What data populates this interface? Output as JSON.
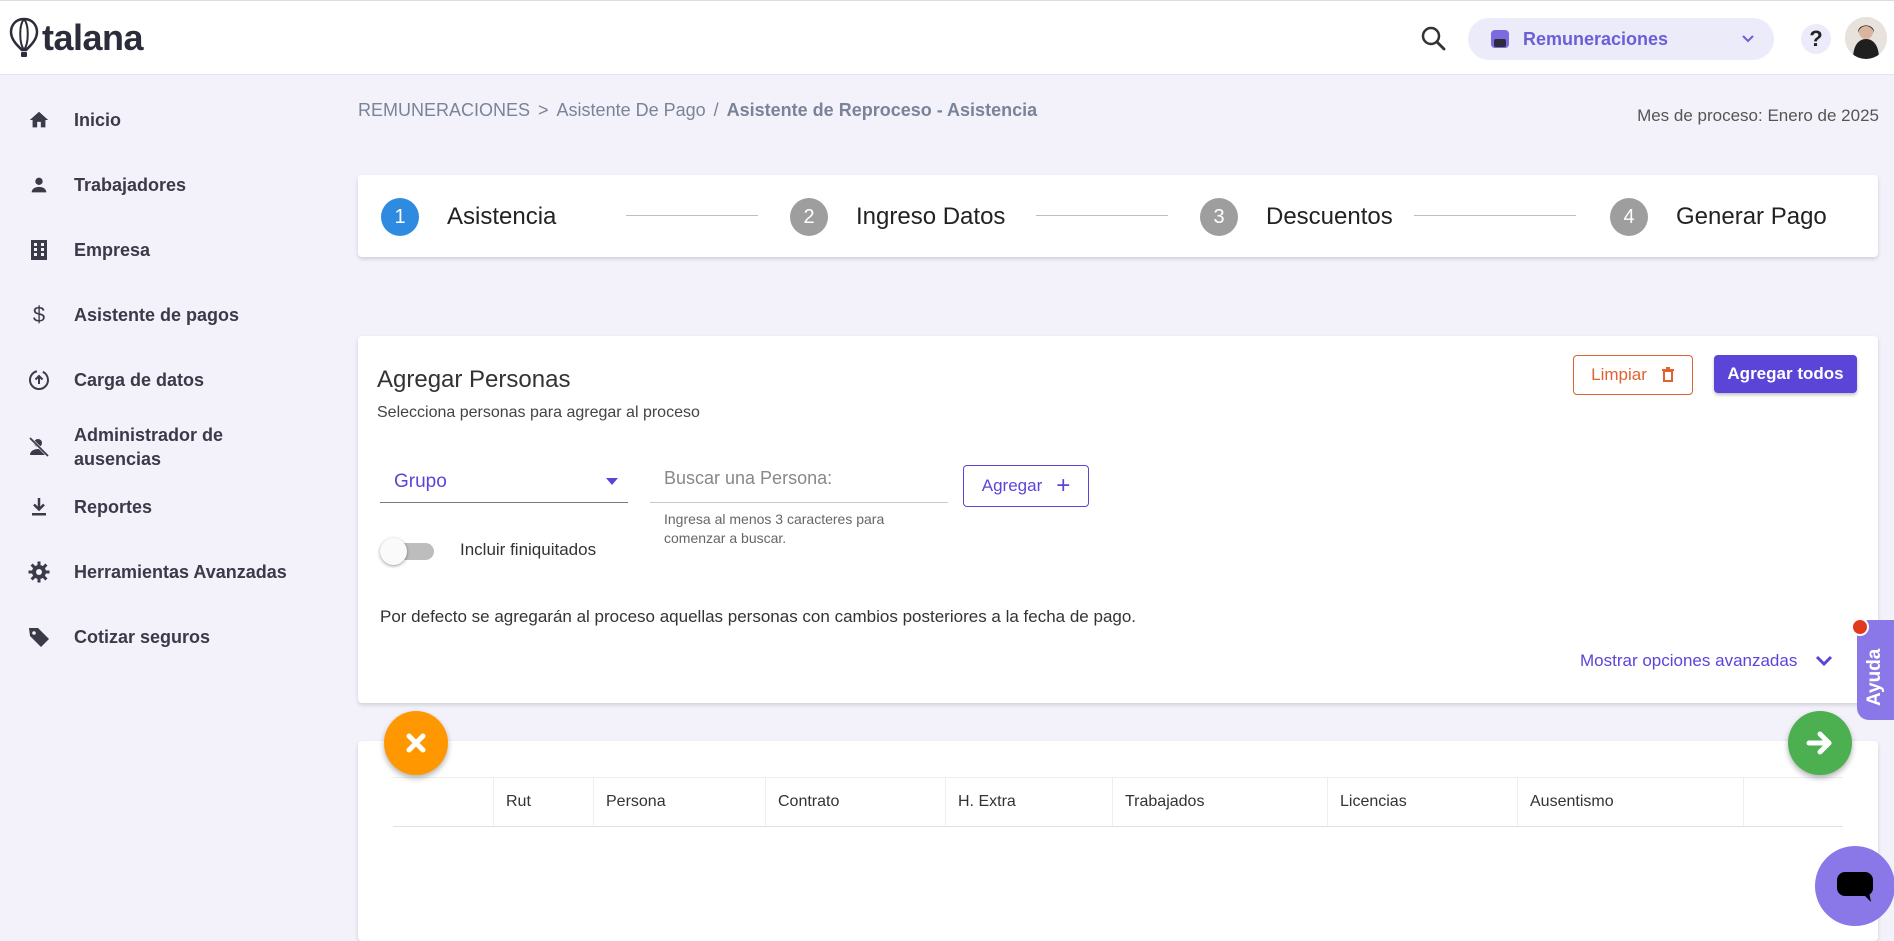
{
  "brand": {
    "name": "talana"
  },
  "header": {
    "module_selector": {
      "label": "Remuneraciones"
    },
    "help_label": "?"
  },
  "sidebar": {
    "items": [
      {
        "label": "Inicio",
        "icon": "home-icon"
      },
      {
        "label": "Trabajadores",
        "icon": "person-icon"
      },
      {
        "label": "Empresa",
        "icon": "building-icon"
      },
      {
        "label": "Asistente de pagos",
        "icon": "dollar-icon"
      },
      {
        "label": "Carga de datos",
        "icon": "upload-circle-icon"
      },
      {
        "label": "Administrador de ausencias",
        "icon": "person-off-icon"
      },
      {
        "label": "Reportes",
        "icon": "download-icon"
      },
      {
        "label": "Herramientas Avanzadas",
        "icon": "gear-icon"
      },
      {
        "label": "Cotizar seguros",
        "icon": "tag-icon"
      }
    ]
  },
  "breadcrumb": {
    "root": "REMUNERACIONES",
    "sep1": ">",
    "parent": "Asistente De Pago",
    "sep2": "/",
    "current": "Asistente de Reproceso - Asistencia"
  },
  "process_month": "Mes de proceso: Enero de 2025",
  "stepper": {
    "steps": [
      {
        "number": "1",
        "label": "Asistencia",
        "active": true
      },
      {
        "number": "2",
        "label": "Ingreso Datos",
        "active": false
      },
      {
        "number": "3",
        "label": "Descuentos",
        "active": false
      },
      {
        "number": "4",
        "label": "Generar Pago",
        "active": false
      }
    ]
  },
  "add_people": {
    "title": "Agregar Personas",
    "subtitle": "Selecciona personas para agregar al proceso",
    "clear_label": "Limpiar",
    "add_all_label": "Agregar todos",
    "group_select": {
      "value": "Grupo"
    },
    "search": {
      "placeholder": "Buscar una Persona:",
      "hint": "Ingresa al menos 3 caracteres para comenzar a buscar."
    },
    "add_label": "Agregar",
    "include_terminated": {
      "label": "Incluir finiquitados",
      "checked": false
    },
    "default_note": "Por defecto se agregarán al proceso aquellas personas con cambios posteriores a la fecha de pago.",
    "advanced_link": "Mostrar opciones avanzadas"
  },
  "table": {
    "columns": [
      "",
      "Rut",
      "Persona",
      "Contrato",
      "H. Extra",
      "Trabajados",
      "Licencias",
      "Ausentismo",
      ""
    ]
  },
  "help_tab": {
    "label": "Ayuda"
  },
  "colors": {
    "accent": "#5b45d9",
    "step_active": "#2f8be0",
    "cancel_fab": "#ff9800",
    "next_fab": "#4caf50",
    "clear_button": "#e06230"
  }
}
